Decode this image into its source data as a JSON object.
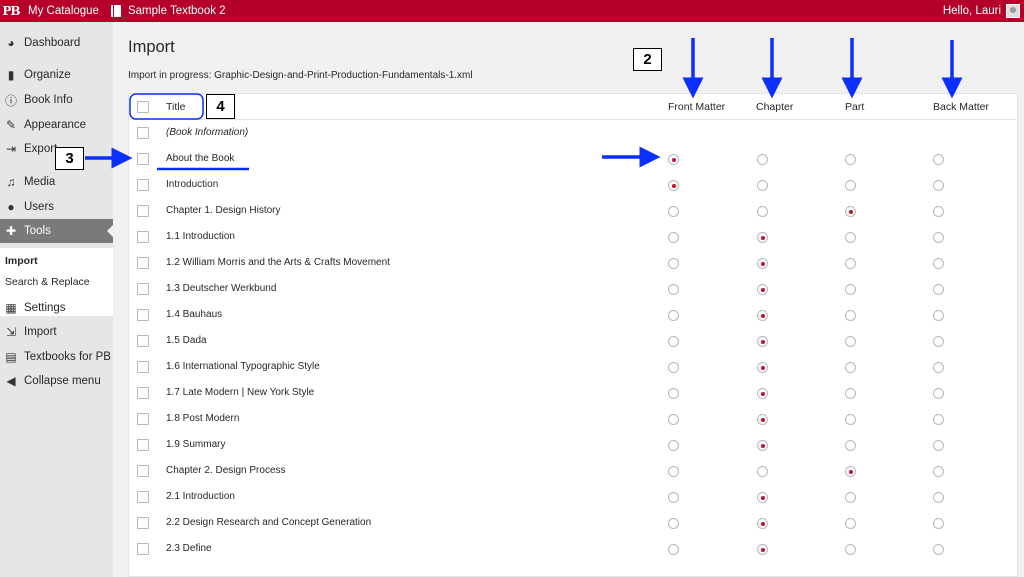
{
  "adminbar": {
    "logo": "PB",
    "my_catalogue": "My Catalogue",
    "book_title": "Sample Textbook 2",
    "greeting": "Hello, Lauri"
  },
  "sidebar": {
    "items": [
      {
        "label": "Dashboard",
        "icon": "dashboard-icon"
      },
      {
        "label": "Organize",
        "icon": "book-icon"
      },
      {
        "label": "Book Info",
        "icon": "info-icon"
      },
      {
        "label": "Appearance",
        "icon": "brush-icon"
      },
      {
        "label": "Export",
        "icon": "export-icon"
      },
      {
        "label": "Media",
        "icon": "media-icon"
      },
      {
        "label": "Users",
        "icon": "users-icon"
      },
      {
        "label": "Tools",
        "icon": "wrench-icon"
      },
      {
        "label": "Settings",
        "icon": "settings-icon"
      },
      {
        "label": "Import",
        "icon": "import-icon"
      },
      {
        "label": "Textbooks for PB",
        "icon": "textbooks-icon"
      },
      {
        "label": "Collapse menu",
        "icon": "collapse-icon"
      }
    ],
    "submenu": [
      "Import",
      "Search & Replace"
    ]
  },
  "main": {
    "title": "Import",
    "progress": "Import in progress: Graphic-Design-and-Print-Production-Fundamentals-1.xml",
    "columns": {
      "title": "Title",
      "front": "Front Matter",
      "chapter": "Chapter",
      "part": "Part",
      "back": "Back Matter"
    },
    "rows": [
      {
        "label": "(Book Information)",
        "type": "none"
      },
      {
        "label": "About the Book",
        "type": "front"
      },
      {
        "label": "Introduction",
        "type": "front"
      },
      {
        "label": "Chapter 1. Design History",
        "type": "part"
      },
      {
        "label": "1.1 Introduction",
        "type": "chapter"
      },
      {
        "label": "1.2 William Morris and the Arts & Crafts Movement",
        "type": "chapter"
      },
      {
        "label": "1.3 Deutscher Werkbund",
        "type": "chapter"
      },
      {
        "label": "1.4 Bauhaus",
        "type": "chapter"
      },
      {
        "label": "1.5 Dada",
        "type": "chapter"
      },
      {
        "label": "1.6 International Typographic Style",
        "type": "chapter"
      },
      {
        "label": "1.7 Late Modern | New York Style",
        "type": "chapter"
      },
      {
        "label": "1.8 Post Modern",
        "type": "chapter"
      },
      {
        "label": "1.9 Summary",
        "type": "chapter"
      },
      {
        "label": "Chapter 2. Design Process",
        "type": "part"
      },
      {
        "label": "2.1 Introduction",
        "type": "chapter"
      },
      {
        "label": "2.2 Design Research and Concept Generation",
        "type": "chapter"
      },
      {
        "label": "2.3 Define",
        "type": "chapter"
      }
    ]
  },
  "annotations": {
    "num2": "2",
    "num3": "3",
    "num4": "4"
  },
  "colors": {
    "brand": "#b5002a",
    "arrow": "#0a2fff",
    "radio_checked": "#c8102e"
  }
}
